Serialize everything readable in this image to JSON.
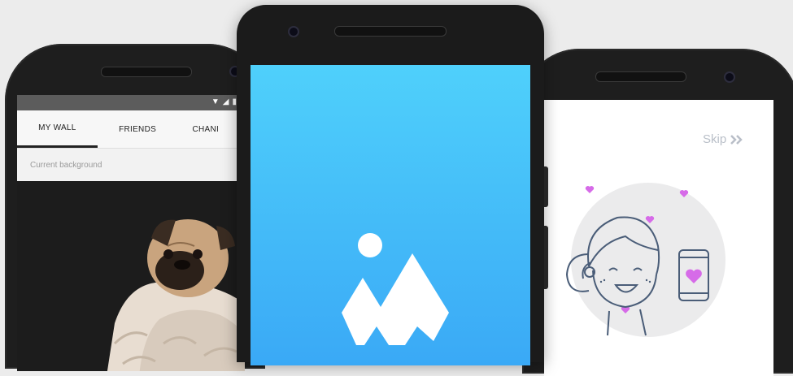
{
  "left_phone": {
    "status_icons": "▼◢▮",
    "tabs": [
      {
        "label": "MY WALL",
        "active": true
      },
      {
        "label": "FRIENDS",
        "active": false
      },
      {
        "label": "CHANI",
        "active": false
      }
    ],
    "background_label": "Current background",
    "photo_subject": "pug-in-blanket"
  },
  "center_phone": {
    "screen_gradient": [
      "#4fd0fb",
      "#3aa9f6"
    ],
    "logo": "mountain-logo-icon"
  },
  "right_phone": {
    "skip_label": "Skip",
    "skip_icon": "double-chevron-right-icon",
    "illustration": "girl-with-phone-hearts-icon",
    "heart_color": "#d66be8"
  }
}
